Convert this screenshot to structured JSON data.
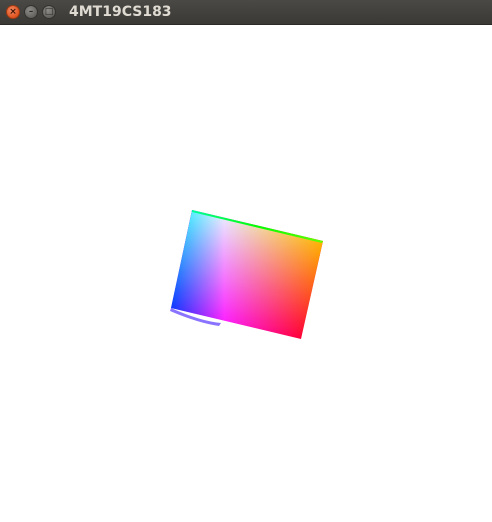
{
  "window": {
    "title": "4MT19CS183",
    "controls": {
      "close_icon": "×",
      "minimize_icon": "–",
      "maximize_icon": "□"
    }
  },
  "scene": {
    "object": "color-cube",
    "background": "#ffffff",
    "face_vertex_colors": {
      "top_left": "#00ffff",
      "top_mid_highlight": "#ffffff",
      "top_right": "#ffff00",
      "bottom_right": "#ff0000",
      "bottom_mid": "#ff00ff",
      "bottom_left": "#0000ff",
      "top_edge_sliver": "#00ff00"
    }
  }
}
